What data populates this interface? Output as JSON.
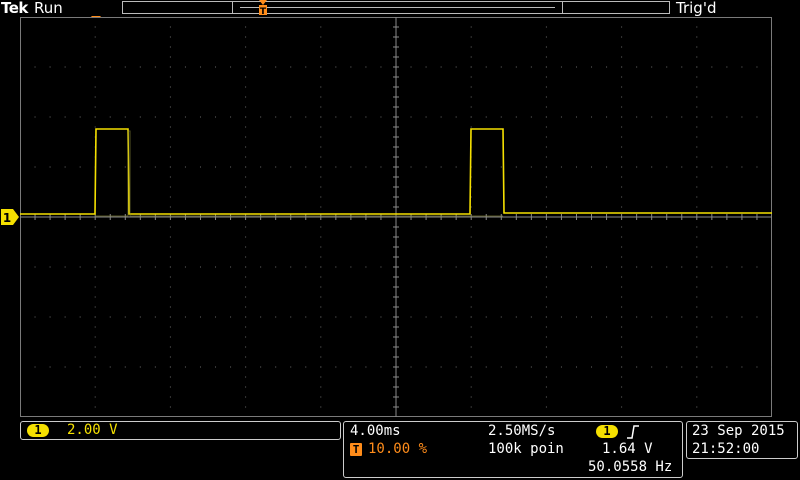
{
  "header": {
    "brand": "Tek",
    "run_state": "Run",
    "trigger_state": "Trig'd"
  },
  "markers": {
    "trigger_position_label": "T",
    "channel_label": "1"
  },
  "channel1": {
    "badge": "1",
    "scale": "2.00 V",
    "color": "#f5e000"
  },
  "horizontal": {
    "time_per_div": "4.00ms",
    "sample_rate": "2.50MS/s",
    "trigger_badge": "T",
    "trigger_position": "10.00 %",
    "record_length": "100k poin",
    "trigger_source_badge": "1",
    "trigger_slope_icon": "rising-edge-icon",
    "trigger_level": "1.64 V",
    "frequency": "50.0558 Hz"
  },
  "datetime": {
    "date": "23 Sep  2015",
    "time": "21:52:00"
  },
  "colors": {
    "trace": "#f5e000",
    "trigger_marker": "#ff8c1a",
    "grid": "#6a6a6a"
  }
}
